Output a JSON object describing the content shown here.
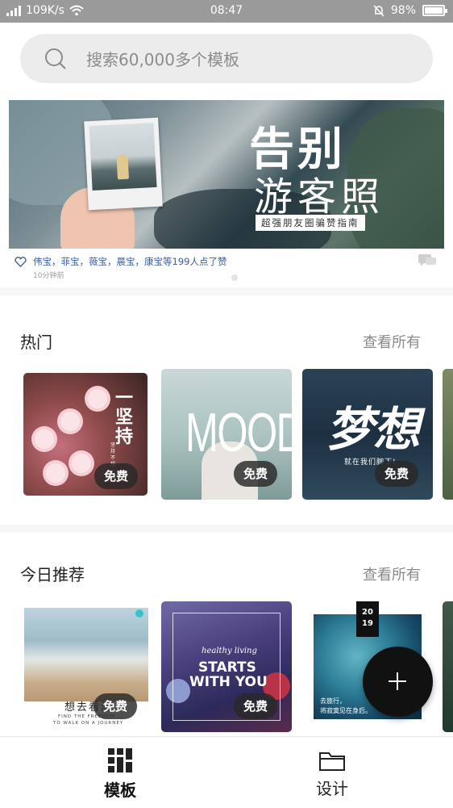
{
  "status_bar": {
    "network_speed": "109K/s",
    "time": "08:47",
    "battery": "98%",
    "battery_level": 0.98
  },
  "search": {
    "placeholder": "搜索60,000多个模板"
  },
  "banner": {
    "headline_1": "告别",
    "headline_2": "游客照",
    "tagline": "超强朋友圈骗赞指南",
    "likes_text": "伟宝，菲宝，薇宝，晨宝，康宝等199人点了赞",
    "time_ago": "10分钟前"
  },
  "sections": {
    "hot": {
      "title": "热门",
      "see_all": "查看所有",
      "cards": [
        {
          "art_text": "一坚持",
          "art_sub": "坚持不想一秒",
          "badge": "免费"
        },
        {
          "art_text": "MOOD",
          "badge": "免费"
        },
        {
          "art_text": "梦想",
          "art_sub": "就在我们脚下!",
          "badge": "免费"
        }
      ]
    },
    "today": {
      "title": "今日推荐",
      "see_all": "查看所有",
      "cards": [
        {
          "art_text": "想去看海",
          "art_sub_1": "FIND THE FREEDOM",
          "art_sub_2": "TO WALK ON A JOURNEY",
          "badge": "免费"
        },
        {
          "art_script": "healthy living",
          "art_line_1": "STARTS",
          "art_line_2": "WITH YOU",
          "badge": "免费"
        },
        {
          "year_top": "20",
          "year_bottom": "19",
          "art_text_1": "去旅行，",
          "art_text_2": "将寂寞见在身后。"
        }
      ]
    }
  },
  "bottom_nav": {
    "items": [
      {
        "label": "模板",
        "icon": "template-grid-icon",
        "active": true
      },
      {
        "label": "设计",
        "icon": "folder-icon",
        "active": false
      }
    ]
  },
  "colors": {
    "status_bar": "#9a9a9a",
    "like_text": "#3b5ea0",
    "fab": "#111111"
  }
}
